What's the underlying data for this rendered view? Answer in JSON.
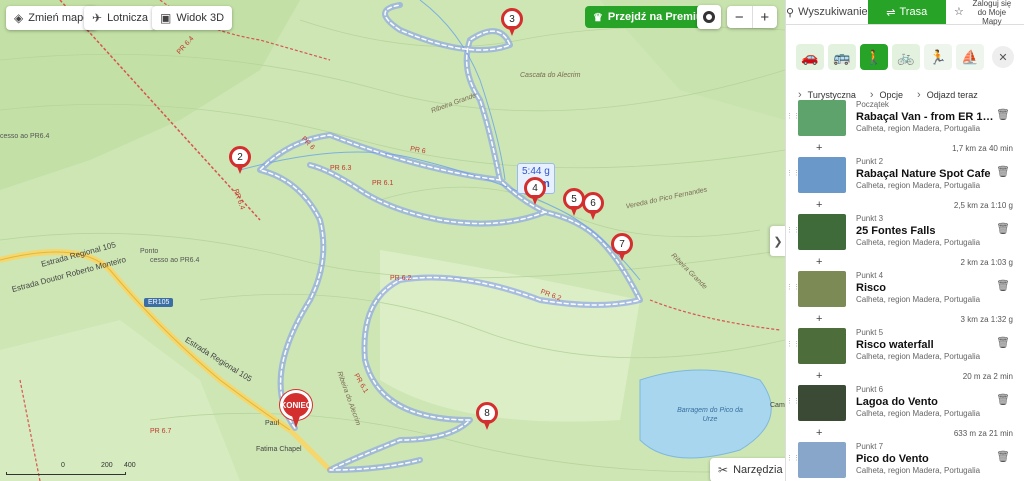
{
  "map": {
    "controls": {
      "change_map": "Zmień mapę",
      "airports": "Lotnicza",
      "view_3d": "Widok 3D",
      "premium": "Przejdź na Premium",
      "zoom_out": "−",
      "zoom_in": "+",
      "tools": "Narzędzia",
      "expand": "❯"
    },
    "distance_label": {
      "time": "5:44 g",
      "km": "km"
    },
    "end_marker": "KONIEC",
    "markers": [
      "2",
      "3",
      "4",
      "5",
      "6",
      "7",
      "8"
    ],
    "scale_labels": [
      "0",
      "200",
      "400"
    ],
    "road_badge": "ER105",
    "route_color": "#4a6fe8",
    "trail_color": "#d9534f",
    "labels": {
      "road1": "Estrada Regional 105",
      "road2": "Estrada Doutor Roberto Monteiro",
      "road3": "Estrada Regional 105",
      "pr61": "PR 6.1",
      "pr62": "PR 6.2",
      "pr6": "PR 6",
      "pr63": "PR 6.3",
      "pr64": "PR 6.4",
      "pr67": "PR 6.7",
      "ribeira_grande": "Ribeira Grande",
      "ribeira_alecrim": "Ribeira do Alecrim",
      "cascata": "Cascata do Alecrim",
      "vereda": "Vereda do Pico Fernandes",
      "ponto": "Ponto",
      "acesso": "cesso ao PR6.4",
      "acesso2": "cesso ao PR6.4",
      "barragem": "Barragem do Pico da Urze",
      "fatima": "Fatima Chapel",
      "paul": "Paul",
      "ribeira_grande2": "Ribeira Grande",
      "cam": "Cam"
    }
  },
  "panel": {
    "tabs": {
      "search": "Wyszukiwanie",
      "route": "Trasa",
      "login": "Zaloguj się do Moje Mapy"
    },
    "options": {
      "tourist": "Turystyczna",
      "options": "Opcje",
      "depart": "Odjazd teraz"
    },
    "stops": [
      {
        "kind": "Początek",
        "name": "Rabaçal Van - from ER 105 ...",
        "loc": "Calheta, region Madera, Portugalia",
        "color": "#5ea36c",
        "seg": "1,7 km za 40 min"
      },
      {
        "kind": "Punkt 2",
        "name": "Rabaçal Nature Spot Cafe",
        "loc": "Calheta, region Madera, Portugalia",
        "color": "#6a98c9",
        "seg": "2,5 km za 1:10 g"
      },
      {
        "kind": "Punkt 3",
        "name": "25 Fontes Falls",
        "loc": "Calheta, region Madera, Portugalia",
        "color": "#3f6b3a",
        "seg": "2 km za 1:03 g"
      },
      {
        "kind": "Punkt 4",
        "name": "Risco",
        "loc": "Calheta, region Madera, Portugalia",
        "color": "#7c8a56",
        "seg": "3 km za 1:32 g"
      },
      {
        "kind": "Punkt 5",
        "name": "Risco waterfall",
        "loc": "Calheta, region Madera, Portugalia",
        "color": "#4d6e3b",
        "seg": "20 m za 2 min"
      },
      {
        "kind": "Punkt 6",
        "name": "Lagoa do Vento",
        "loc": "Calheta, region Madera, Portugalia",
        "color": "#3b4a35",
        "seg": "633 m za 21 min"
      },
      {
        "kind": "Punkt 7",
        "name": "Pico do Vento",
        "loc": "Calheta, region Madera, Portugalia",
        "color": "#88a6c9",
        "seg": ""
      }
    ]
  }
}
